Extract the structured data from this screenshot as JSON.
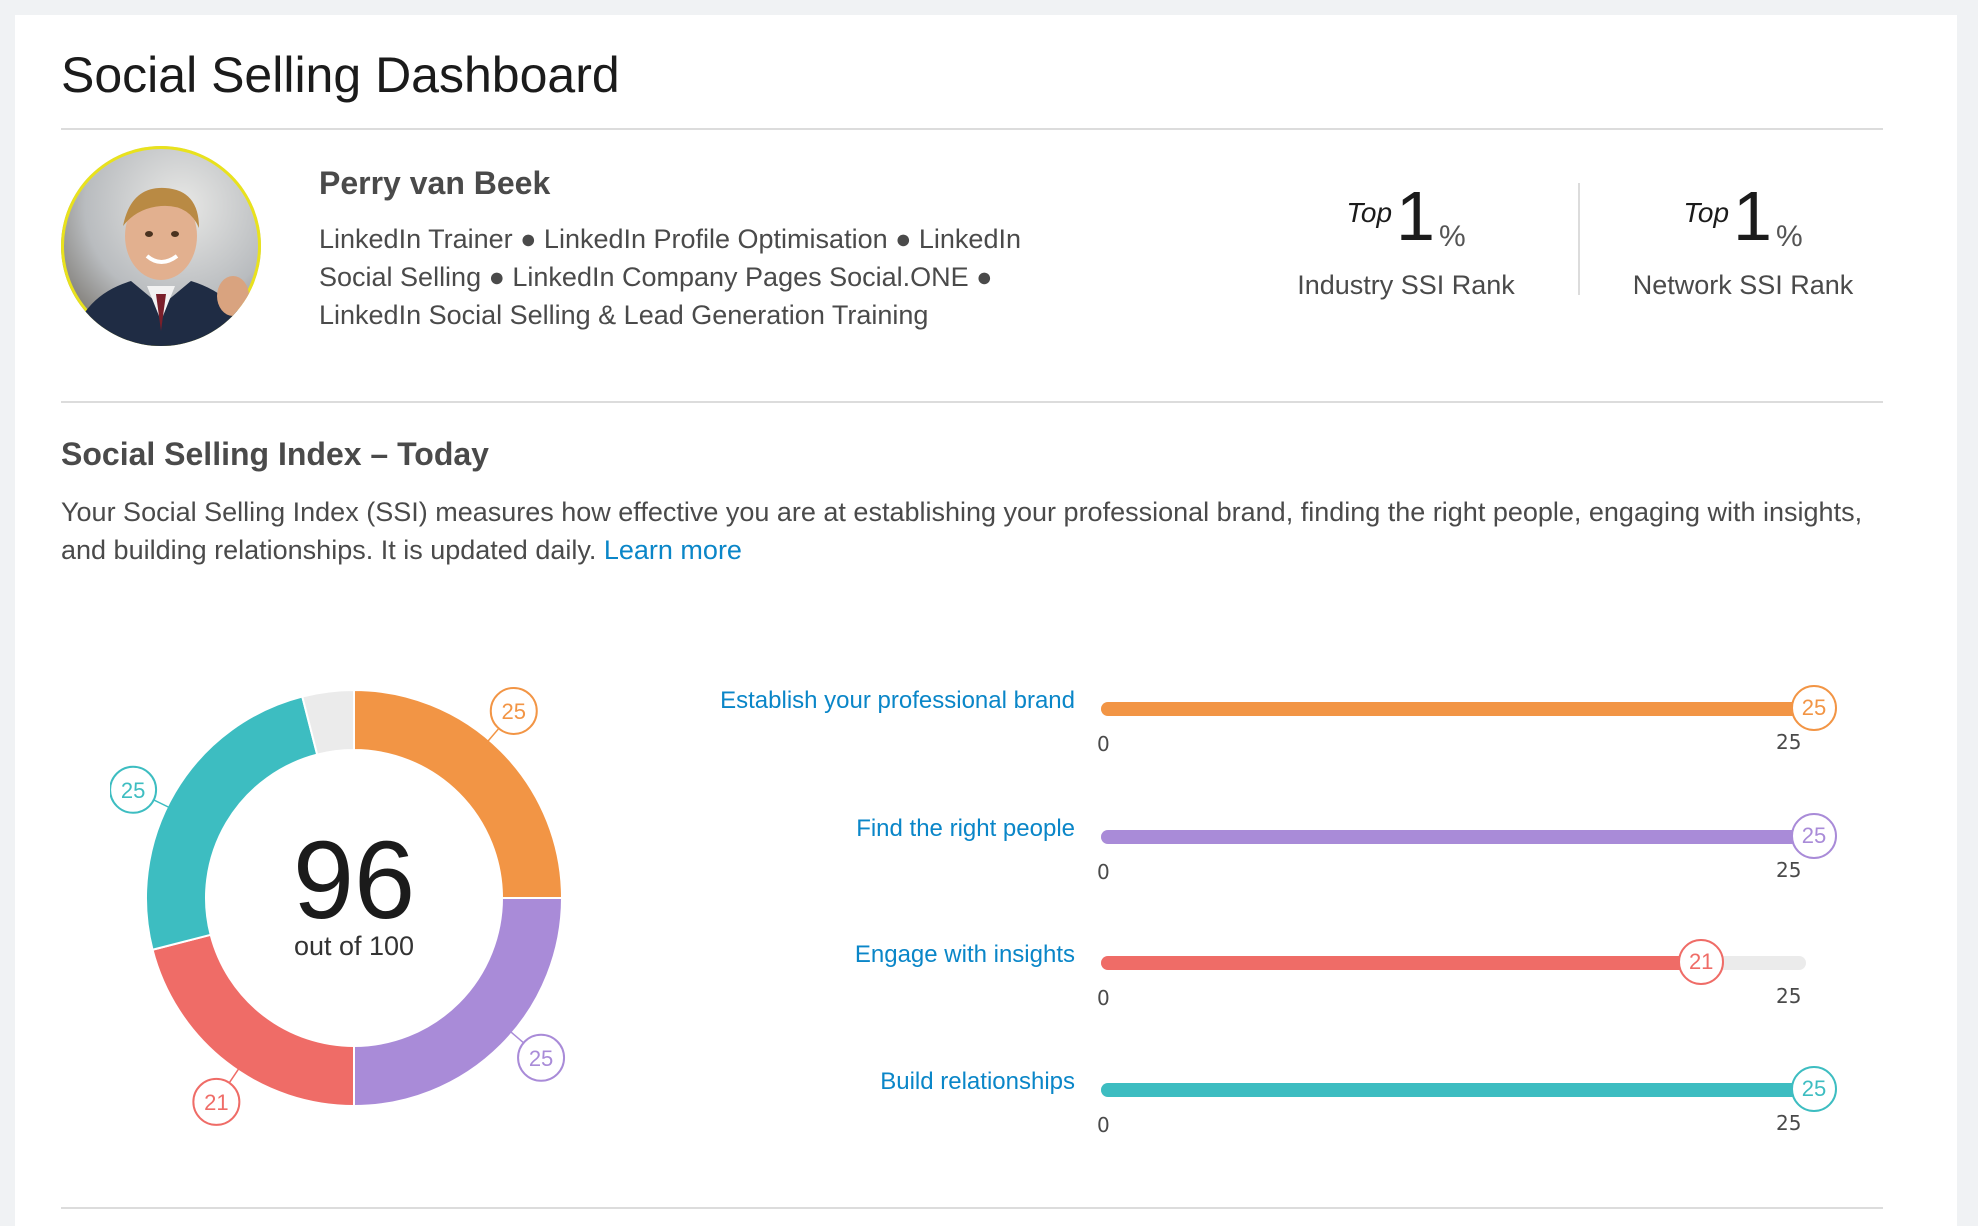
{
  "page_title": "Social Selling Dashboard",
  "profile": {
    "name": "Perry van Beek",
    "headline": "LinkedIn Trainer ● LinkedIn Profile Optimisation ● LinkedIn Social Selling ● LinkedIn Company Pages Social.ONE ● LinkedIn Social Selling & Lead Generation Training"
  },
  "ranks": [
    {
      "top_label": "Top",
      "value": "1",
      "unit": "%",
      "label": "Industry SSI Rank"
    },
    {
      "top_label": "Top",
      "value": "1",
      "unit": "%",
      "label": "Network SSI Rank"
    }
  ],
  "ssi": {
    "title": "Social Selling Index – Today",
    "description": "Your Social Selling Index (SSI) measures how effective you are at establishing your professional brand, finding the right people, engaging with insights, and building relationships. It is updated daily.",
    "learn_more": "Learn more",
    "score": "96",
    "score_caption": "out of 100"
  },
  "colors": {
    "brand": "#f29545",
    "people": "#a98bd8",
    "insights": "#ef6c67",
    "relationships": "#3dbdc1",
    "remainder": "#ebebeb",
    "link": "#0a86c8"
  },
  "icons": {
    "avatar": "profile-photo"
  },
  "chart_data": {
    "type": "bar",
    "categories": [
      "Establish your professional brand",
      "Find the right people",
      "Engage with insights",
      "Build relationships"
    ],
    "values": [
      25,
      25,
      21,
      25
    ],
    "max": 25,
    "min_label": "0",
    "max_label": "25",
    "total": 96,
    "total_max": 100
  }
}
